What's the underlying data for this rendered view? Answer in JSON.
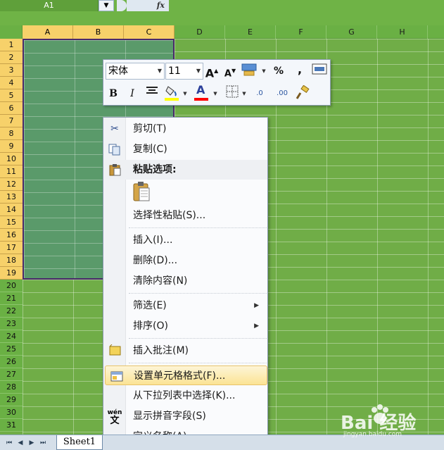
{
  "formula_bar": {
    "name_box": "A1",
    "fx": "fx"
  },
  "columns": [
    "A",
    "B",
    "C",
    "D",
    "E",
    "F",
    "G",
    "H"
  ],
  "rows": [
    "1",
    "2",
    "3",
    "4",
    "5",
    "6",
    "7",
    "8",
    "9",
    "10",
    "11",
    "12",
    "13",
    "14",
    "15",
    "16",
    "17",
    "18",
    "19",
    "20",
    "21",
    "22",
    "23",
    "24",
    "25",
    "26",
    "27",
    "28",
    "29",
    "30",
    "31"
  ],
  "mini_toolbar": {
    "font_name": "宋体",
    "font_size": "11",
    "grow_font": "A",
    "shrink_font": "A",
    "percent": "%",
    "comma": ",",
    "bold": "B",
    "italic": "I",
    "font_color": "A",
    "inc_decimal": ".0",
    "dec_decimal": ".00",
    "colors": {
      "highlight": "#ffff00",
      "font": "#ff0000"
    }
  },
  "context_menu": {
    "cut": "剪切(T)",
    "copy": "复制(C)",
    "paste_options": "粘贴选项:",
    "paste_special": "选择性粘贴(S)...",
    "insert": "插入(I)...",
    "delete": "删除(D)...",
    "clear": "清除内容(N)",
    "filter": "筛选(E)",
    "sort": "排序(O)",
    "insert_comment": "插入批注(M)",
    "format_cells": "设置单元格格式(F)...",
    "pick_list": "从下拉列表中选择(K)...",
    "phonetic": "显示拼音字段(S)",
    "define_name": "定义名称(A)...",
    "phonetic_icon_text": "wén"
  },
  "sheet_tabs": {
    "active": "Sheet1"
  },
  "watermark": {
    "brand": "Bai 经验",
    "sub": "jingyan.baidu.com"
  }
}
